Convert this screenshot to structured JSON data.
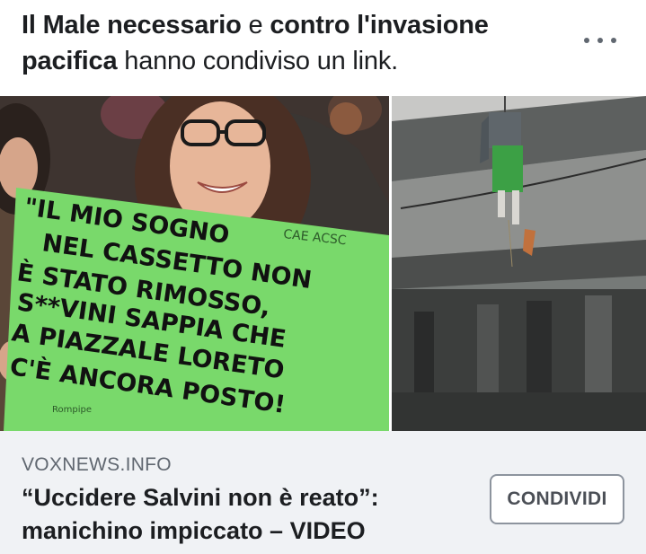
{
  "post": {
    "group1": "Il Male necessario",
    "conj": " e ",
    "group2": "contro l'invasione pacifica",
    "action": " hanno condiviso un link.",
    "more_icon": "more-horizontal-icon"
  },
  "media": {
    "sign_lines": [
      "\"IL MIO SOGNO",
      "NEL CASSETTO NON",
      "È STATO RIMOSSO,",
      "S**VINI SAPPIA CHE",
      "A PIAZZALE LORETO",
      "C'È ANCORA POSTO!"
    ],
    "sign_tag": "CAE ACSC",
    "sign_signature": "Rompipe",
    "sign_color": "#79d96b"
  },
  "link": {
    "domain": "VOXNEWS.INFO",
    "title": "“Uccidere Salvini non è reato”: manichino impiccato – VIDEO",
    "share_label": "CONDIVIDI"
  }
}
